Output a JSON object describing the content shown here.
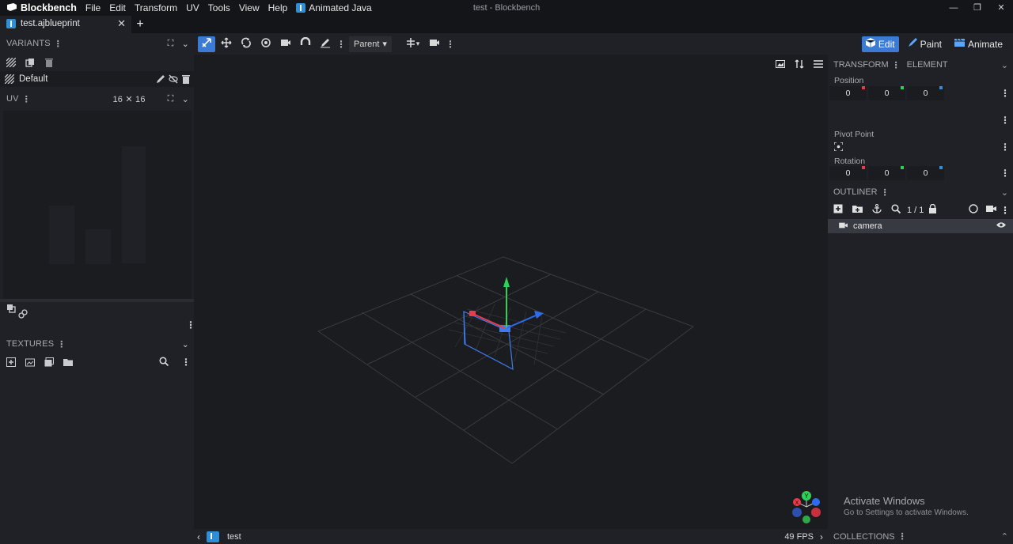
{
  "app": {
    "name": "Blockbench",
    "window_title": "test - Blockbench",
    "menu": [
      "File",
      "Edit",
      "Transform",
      "UV",
      "Tools",
      "View",
      "Help"
    ],
    "plugin_menu": "Animated Java"
  },
  "tabs": {
    "file_tab": "test.ajblueprint",
    "close": "✕",
    "add": "+"
  },
  "left_panel": {
    "variants_title": "VARIANTS",
    "variant_default": "Default",
    "uv_title": "UV",
    "uv_size": "16 ✕ 16",
    "textures_title": "TEXTURES"
  },
  "toolbar": {
    "transform_space": "Parent",
    "modes": [
      {
        "label": "Edit",
        "active": true
      },
      {
        "label": "Paint",
        "active": false
      },
      {
        "label": "Animate",
        "active": false
      }
    ]
  },
  "right_panel": {
    "tabs": [
      "TRANSFORM",
      "ELEMENT"
    ],
    "position_label": "Position",
    "position": [
      "0",
      "0",
      "0"
    ],
    "pivot_label": "Pivot Point",
    "rotation_label": "Rotation",
    "rotation": [
      "0",
      "0",
      "0"
    ],
    "outliner_title": "OUTLINER",
    "outliner_count": "1 / 1",
    "outliner_items": [
      {
        "name": "camera"
      }
    ],
    "collections_title": "COLLECTIONS"
  },
  "status": {
    "project_name": "test",
    "fps": "49 FPS"
  },
  "watermark": {
    "title": "Activate Windows",
    "subtitle": "Go to Settings to activate Windows."
  },
  "colors": {
    "accent": "#3a7bd5",
    "axis_x": "#e93b4b",
    "axis_y": "#2ed157",
    "axis_z": "#2d8fe5",
    "background": "#1b1c1f",
    "panel": "#1f2126"
  }
}
